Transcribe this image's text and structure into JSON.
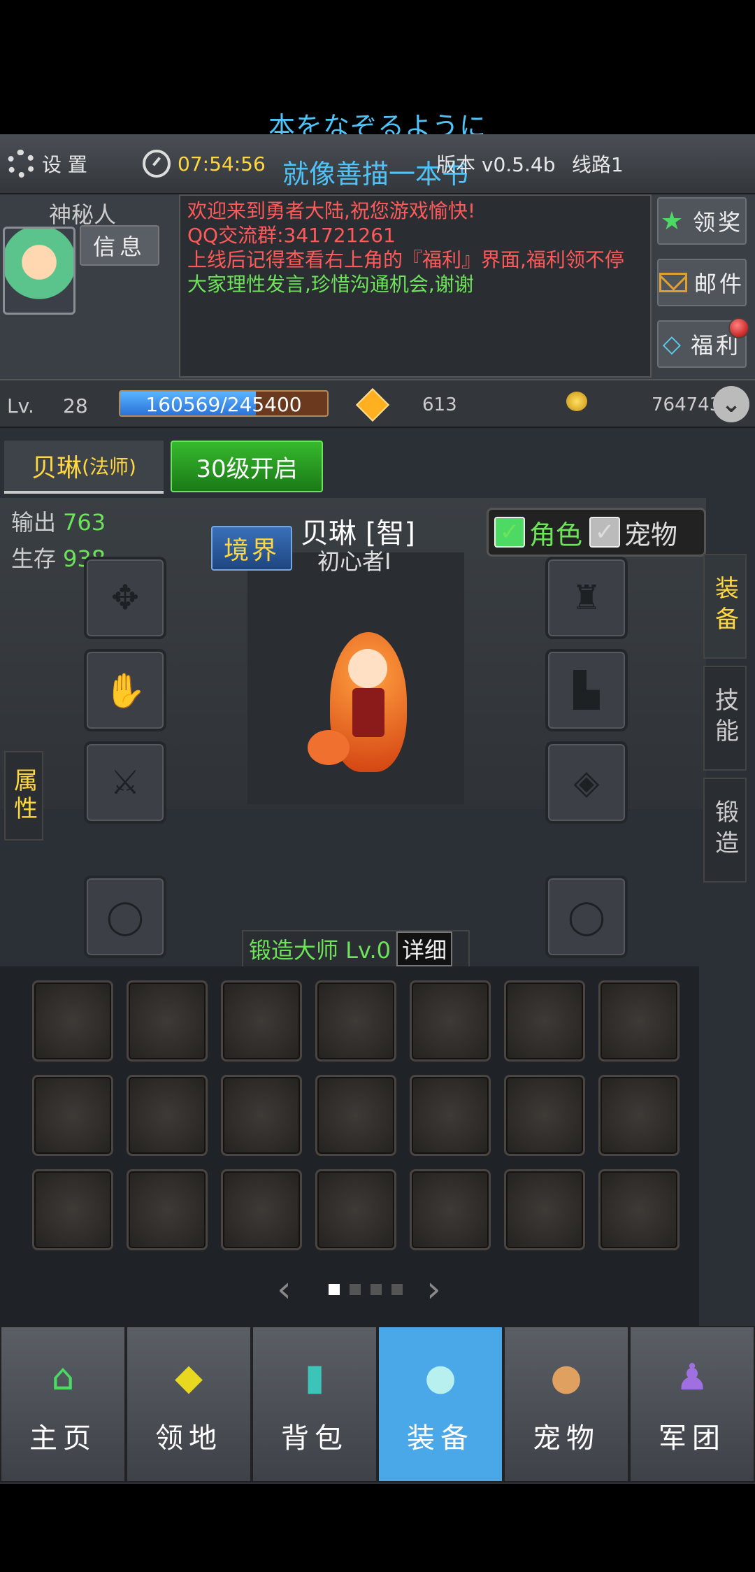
{
  "overlay": {
    "caption": "本をなぞるように",
    "scroll_text": "就像善描一本书"
  },
  "topbar": {
    "settings_label": "设 置",
    "time": "07:54:56",
    "version": "版本 v0.5.4b",
    "line": "线路1"
  },
  "player": {
    "name": "神秘人",
    "info_button": "信息"
  },
  "chat": {
    "lines": [
      {
        "text": "欢迎来到勇者大陆,祝您游戏愉快!",
        "color": "red"
      },
      {
        "text": "QQ交流群:341721261",
        "color": "red"
      },
      {
        "text": "上线后记得查看右上角的『福利』界面,福利领不停",
        "color": "red"
      },
      {
        "text": "大家理性发言,珍惜沟通机会,谢谢",
        "color": "green"
      }
    ]
  },
  "side_buttons": {
    "reward": "领奖",
    "mail": "邮件",
    "welfare": "福利"
  },
  "level": {
    "label": "Lv.",
    "value": "28",
    "exp_text": "160569/245400",
    "exp_progress": 0.654,
    "gems": "613",
    "gold": "764743"
  },
  "tabs": {
    "character": "贝琳",
    "character_class": "(法师)",
    "locked": "30级开启"
  },
  "stats": {
    "output_label": "输出",
    "output_value": "763",
    "survive_label": "生存",
    "survive_value": "938"
  },
  "hero": {
    "realm_button": "境界",
    "name": "贝琳 [智]",
    "title": "初心者I"
  },
  "toggles": {
    "character": "角色",
    "pet": "宠物"
  },
  "side_tabs": {
    "attributes": "属性",
    "equipment": "装备",
    "skills": "技能",
    "forge": "锻造"
  },
  "forge": {
    "label": "锻造大师 Lv.0",
    "detail_button": "详细"
  },
  "nav": {
    "home": "主页",
    "territory": "领地",
    "bag": "背包",
    "equip": "装备",
    "pet": "宠物",
    "legion": "军团"
  }
}
